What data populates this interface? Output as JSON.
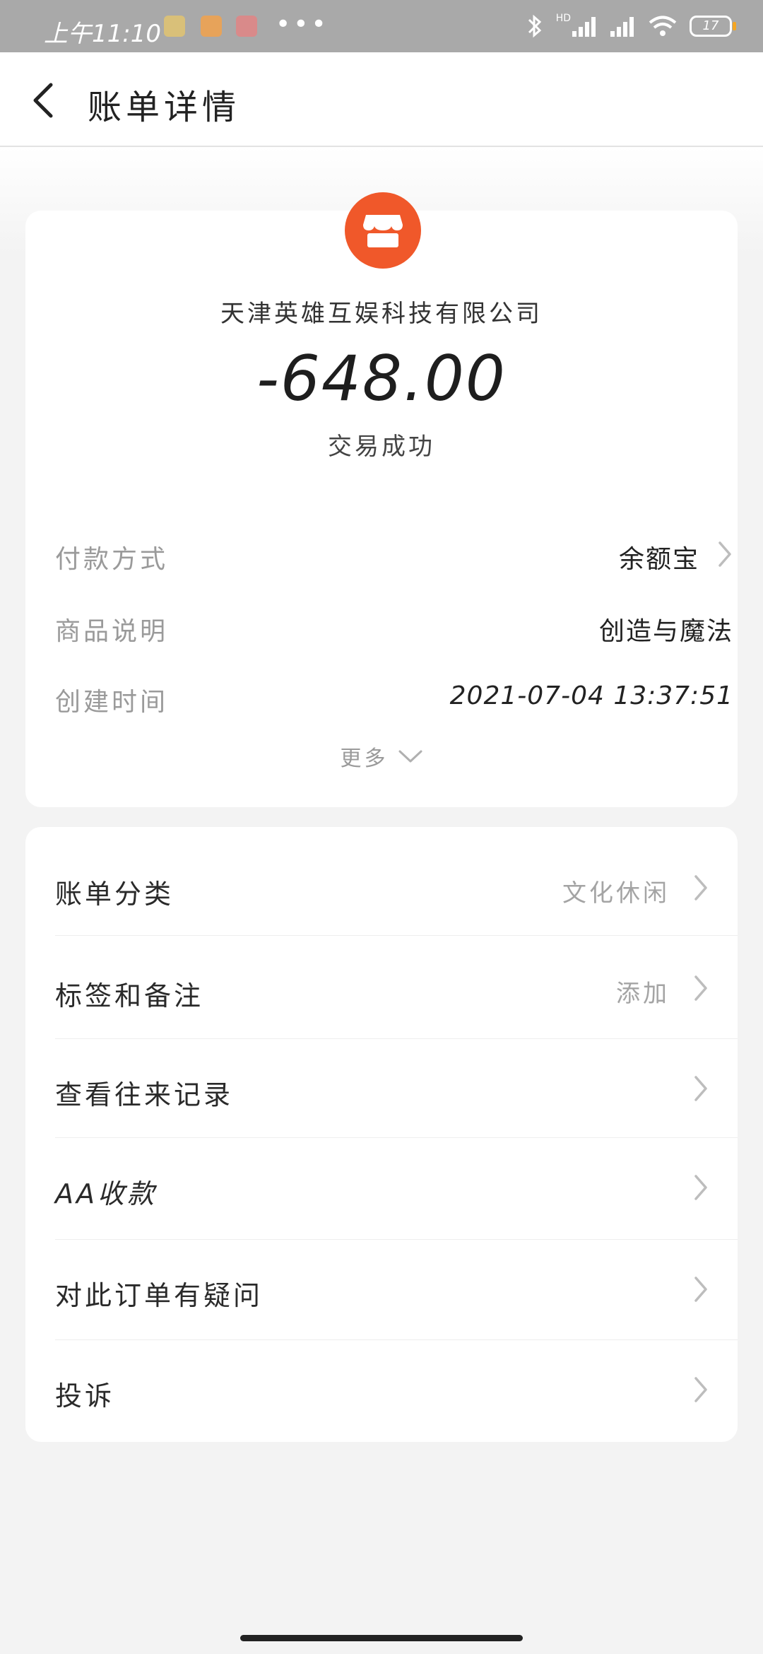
{
  "status_bar": {
    "time": "上午11:10",
    "more": "•••",
    "battery": "17",
    "network": "HD"
  },
  "header": {
    "title": "账单详情"
  },
  "transaction": {
    "merchant": "天津英雄互娱科技有限公司",
    "amount": "-648.00",
    "status": "交易成功",
    "logo_color": "#f0582a"
  },
  "details": [
    {
      "label": "付款方式",
      "value": "余额宝"
    },
    {
      "label": "商品说明",
      "value": "创造与魔法"
    },
    {
      "label": "创建时间",
      "value": "2021-07-04 13:37:51"
    }
  ],
  "more_label": "更多",
  "menu": [
    {
      "label": "账单分类",
      "value": "文化休闲"
    },
    {
      "label": "标签和备注",
      "value": "添加"
    },
    {
      "label": "查看往来记录",
      "value": ""
    },
    {
      "label": "AA收款",
      "value": ""
    },
    {
      "label": "对此订单有疑问",
      "value": ""
    },
    {
      "label": "投诉",
      "value": ""
    }
  ]
}
